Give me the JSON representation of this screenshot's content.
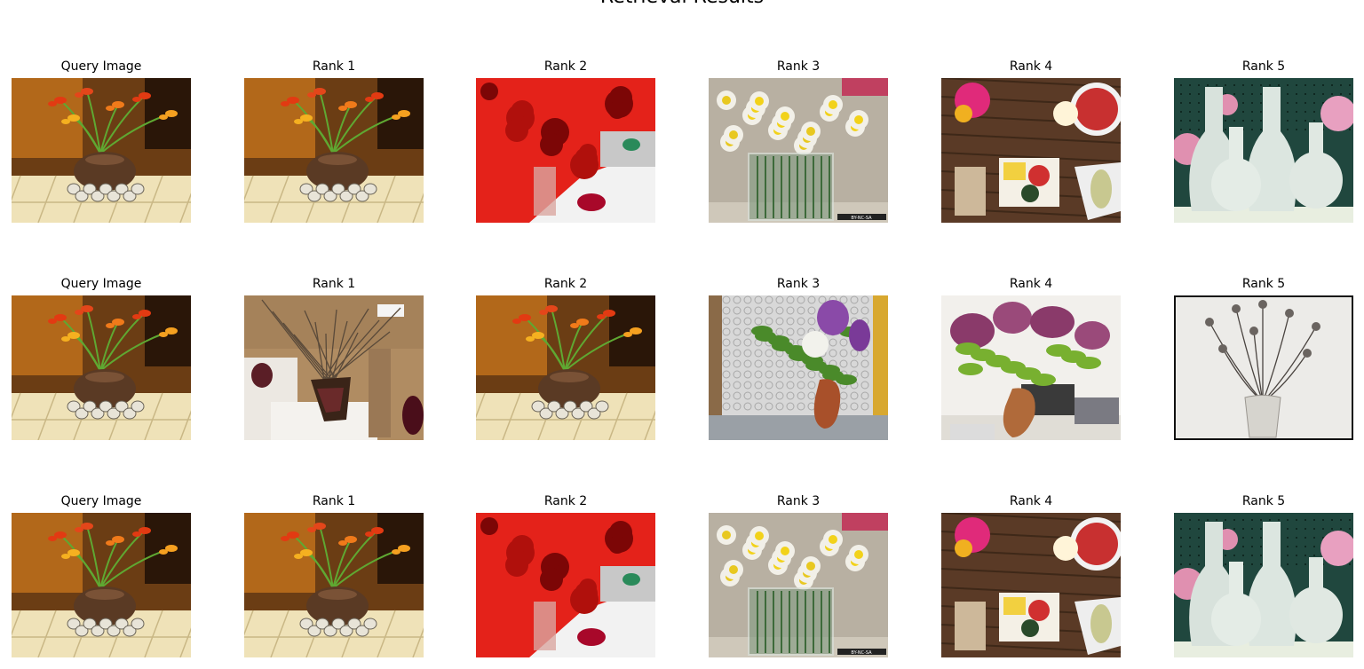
{
  "figure": {
    "title": "Retrieval Results"
  },
  "rows": [
    {
      "cells": [
        {
          "label": "Query Image",
          "scene": "freesia"
        },
        {
          "label": "Rank 1",
          "scene": "freesia"
        },
        {
          "label": "Rank 2",
          "scene": "red"
        },
        {
          "label": "Rank 3",
          "scene": "daffodil"
        },
        {
          "label": "Rank 4",
          "scene": "table"
        },
        {
          "label": "Rank 5",
          "scene": "whitevase"
        }
      ]
    },
    {
      "cells": [
        {
          "label": "Query Image",
          "scene": "freesia"
        },
        {
          "label": "Rank 1",
          "scene": "dried"
        },
        {
          "label": "Rank 2",
          "scene": "freesia"
        },
        {
          "label": "Rank 3",
          "scene": "lilacdoor"
        },
        {
          "label": "Rank 4",
          "scene": "lilacdesk"
        },
        {
          "label": "Rank 5",
          "scene": "sketch"
        }
      ]
    },
    {
      "cells": [
        {
          "label": "Query Image",
          "scene": "freesia"
        },
        {
          "label": "Rank 1",
          "scene": "freesia"
        },
        {
          "label": "Rank 2",
          "scene": "red"
        },
        {
          "label": "Rank 3",
          "scene": "daffodil"
        },
        {
          "label": "Rank 4",
          "scene": "table"
        },
        {
          "label": "Rank 5",
          "scene": "whitevase"
        }
      ]
    }
  ],
  "watermark_text": "BY-NC-SA"
}
